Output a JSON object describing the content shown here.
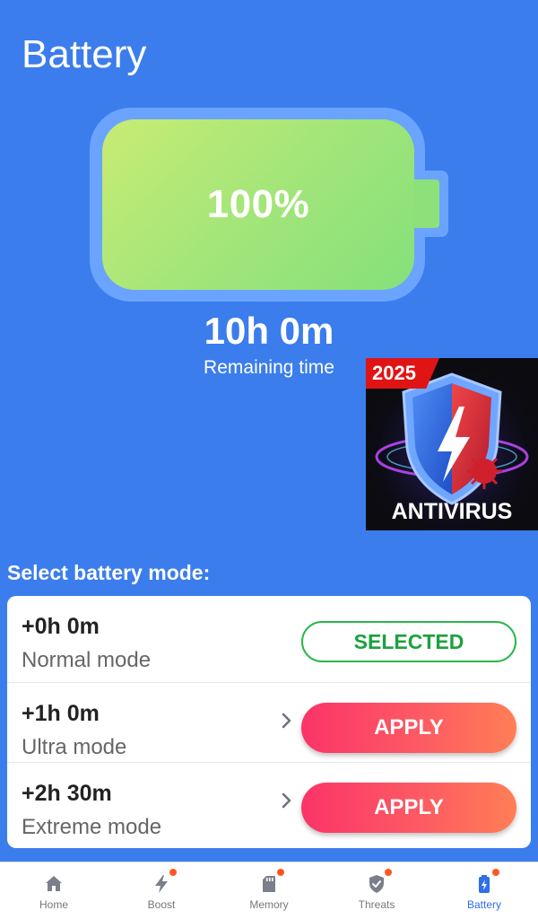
{
  "header": {
    "title": "Battery"
  },
  "battery": {
    "level_percent": 100,
    "percent_label": "100%",
    "remaining_time": "10h 0m",
    "remaining_label": "Remaining time"
  },
  "ad": {
    "badge": "2025",
    "title": "ANTIVIRUS"
  },
  "modes": {
    "heading": "Select battery mode:",
    "items": [
      {
        "time": "+0h 0m",
        "name": "Normal mode",
        "action": "SELECTED"
      },
      {
        "time": "+1h 0m",
        "name": "Ultra mode",
        "action": "APPLY"
      },
      {
        "time": "+2h 30m",
        "name": "Extreme mode",
        "action": "APPLY"
      }
    ]
  },
  "nav": {
    "items": [
      {
        "label": "Home",
        "icon": "home-icon",
        "dot": false
      },
      {
        "label": "Boost",
        "icon": "lightning-icon",
        "dot": true
      },
      {
        "label": "Memory",
        "icon": "sd-card-icon",
        "dot": true
      },
      {
        "label": "Threats",
        "icon": "shield-check-icon",
        "dot": true
      },
      {
        "label": "Battery",
        "icon": "battery-icon",
        "dot": true,
        "active": true
      }
    ]
  },
  "colors": {
    "background": "#3b7ded",
    "selected_green": "#29b64a",
    "apply_gradient_start": "#fb3468",
    "apply_gradient_end": "#ff7e55",
    "nav_active": "#2f6fe8",
    "notification_dot": "#ff5722"
  }
}
